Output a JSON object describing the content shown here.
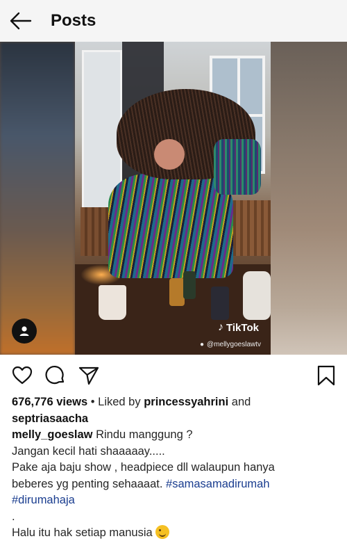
{
  "header": {
    "title": "Posts"
  },
  "media": {
    "watermark_brand": "TikTok",
    "watermark_handle": "@mellygoeslawtv"
  },
  "stats": {
    "views": "676,776 views",
    "liked_by_prefix": "• Liked by",
    "liked_user1": "princessyahrini",
    "and": "and",
    "liked_user2": "septriasaacha"
  },
  "caption": {
    "username": "melly_goeslaw",
    "line1": "Rindu manggung ?",
    "line2": "Jangan kecil hati shaaaaay.....",
    "line3": "Pake aja baju show , headpiece dll walaupun hanya",
    "line4": "beberes yg penting sehaaaat.",
    "hashtag1": "#samasamadirumah",
    "hashtag2": "#dirumahaja",
    "dot": ".",
    "line5": "Halu itu hak setiap manusia"
  },
  "icons": {
    "back": "arrow-left-icon",
    "like": "heart-icon",
    "comment": "comment-bubble-icon",
    "share": "paper-plane-icon",
    "save": "bookmark-icon",
    "user_tag": "user-icon"
  }
}
